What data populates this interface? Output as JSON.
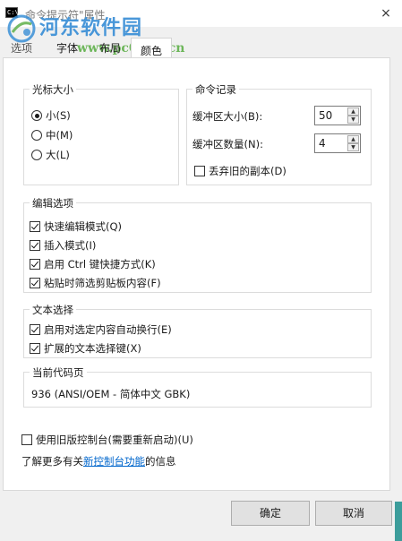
{
  "window": {
    "title": "命令提示符\"属性",
    "close_glyph": "×",
    "icon_label": "C:\\"
  },
  "watermark": {
    "name": "河东软件园",
    "url": "www.pc0359.cn"
  },
  "tabs": [
    {
      "label": "选项"
    },
    {
      "label": "字体"
    },
    {
      "label": "布局"
    },
    {
      "label": "颜色"
    }
  ],
  "cursor_size": {
    "title": "光标大小",
    "options": [
      {
        "label": "小(S)",
        "selected": true
      },
      {
        "label": "中(M)",
        "selected": false
      },
      {
        "label": "大(L)",
        "selected": false
      }
    ]
  },
  "command_history": {
    "title": "命令记录",
    "buffer_size": {
      "label": "缓冲区大小(B):",
      "value": "50"
    },
    "buffer_count": {
      "label": "缓冲区数量(N):",
      "value": "4"
    },
    "discard_old": {
      "label": "丢弃旧的副本(D)",
      "checked": false
    }
  },
  "edit_options": {
    "title": "编辑选项",
    "items": [
      {
        "label": "快速编辑模式(Q)",
        "checked": true
      },
      {
        "label": "插入模式(I)",
        "checked": true
      },
      {
        "label": "启用 Ctrl 键快捷方式(K)",
        "checked": true
      },
      {
        "label": "粘贴时筛选剪贴板内容(F)",
        "checked": true
      }
    ]
  },
  "text_selection": {
    "title": "文本选择",
    "items": [
      {
        "label": "启用对选定内容自动换行(E)",
        "checked": true
      },
      {
        "label": "扩展的文本选择键(X)",
        "checked": true
      }
    ]
  },
  "codepage": {
    "title": "当前代码页",
    "value": "936   (ANSI/OEM - 简体中文 GBK)"
  },
  "legacy": {
    "label": "使用旧版控制台(需要重新启动)(U)",
    "checked": false
  },
  "learn_more": {
    "prefix": "了解更多有关",
    "link": "新控制台功能",
    "suffix": "的信息"
  },
  "buttons": {
    "ok": "确定",
    "cancel": "取消"
  },
  "colors": {
    "accent_link": "#0066cc",
    "watermark_blue": "#3a8fd6",
    "watermark_green": "#5fb04a"
  }
}
